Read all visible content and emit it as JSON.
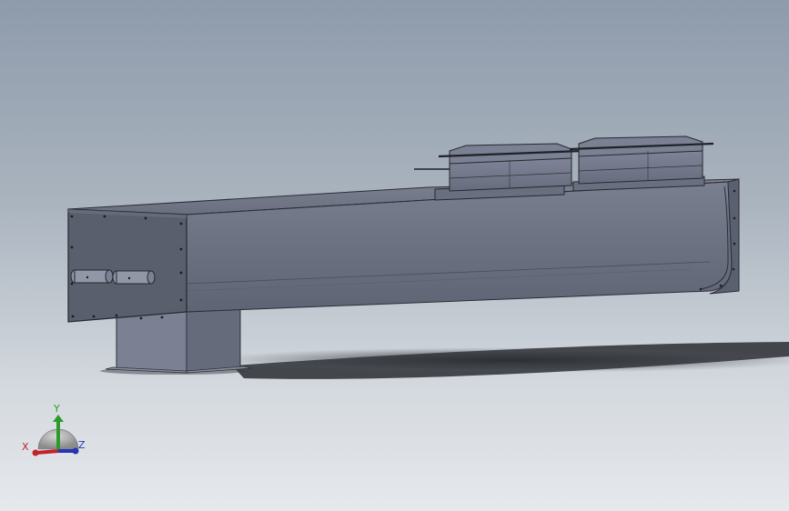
{
  "triad": {
    "x_label": "X",
    "y_label": "Y",
    "z_label": "Z",
    "colors": {
      "x": "#c0232b",
      "y": "#2c9b2c",
      "z": "#2436b8"
    }
  },
  "colors": {
    "background_top": "#8e9bab",
    "background_bottom": "#e6e9ec",
    "body_face": "#6f7484",
    "end_plate": "#5d6271",
    "support": "#71768a"
  }
}
